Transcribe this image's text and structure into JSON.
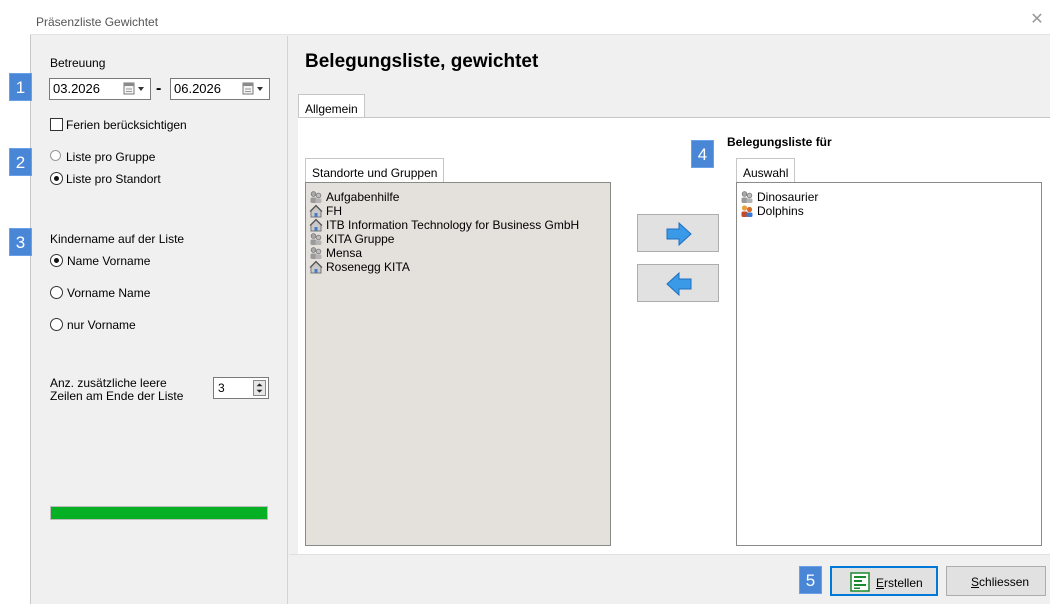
{
  "window": {
    "title": "Präsenzliste Gewichtet"
  },
  "badges": [
    "1",
    "2",
    "3",
    "4",
    "5"
  ],
  "left": {
    "betreuung_label": "Betreuung",
    "date_from": "03.2026",
    "date_to": "06.2026",
    "date_separator": "-",
    "ferien_label": "Ferien berücksichtigen",
    "ferien_checked": false,
    "list_mode": {
      "options": [
        "Liste pro Gruppe",
        "Liste pro Standort"
      ],
      "selected": "Liste pro Standort"
    },
    "kindername_label": "Kindername auf der Liste",
    "kindername": {
      "options": [
        "Name Vorname",
        "Vorname Name",
        "nur Vorname"
      ],
      "selected": "Name Vorname"
    },
    "extra_rows_label_1": "Anz. zusätzliche leere",
    "extra_rows_label_2": "Zeilen am Ende der Liste",
    "extra_rows_value": "3",
    "progress_percent": 100
  },
  "main": {
    "heading": "Belegungsliste, gewichtet",
    "tab_label": "Allgemein",
    "source_group_label": "Standorte und Gruppen",
    "source_items": [
      {
        "label": "Aufgabenhilfe",
        "icon": "group-icon"
      },
      {
        "label": "FH",
        "icon": "location-icon"
      },
      {
        "label": "ITB Information Technology for Business GmbH",
        "icon": "location-icon"
      },
      {
        "label": "KITA Gruppe",
        "icon": "group-icon"
      },
      {
        "label": "Mensa",
        "icon": "group-icon"
      },
      {
        "label": "Rosenegg KITA",
        "icon": "location-icon"
      }
    ],
    "target_heading": "Belegungsliste für",
    "target_tab_label": "Auswahl",
    "target_items": [
      {
        "label": "Dinosaurier",
        "icon": "group-icon"
      },
      {
        "label": "Dolphins",
        "icon": "kids-group-icon"
      }
    ]
  },
  "buttons": {
    "create_label": "Erstellen",
    "create_mnemonic": "E",
    "create_rest": "rstellen",
    "close_label": "Schliessen",
    "close_mnemonic": "S",
    "close_rest": "chliessen"
  },
  "colors": {
    "accent_badge": "#4a86d6",
    "progress": "#06b025",
    "arrow": "#3a9ae8",
    "listbox_bg": "#e4e0db"
  }
}
